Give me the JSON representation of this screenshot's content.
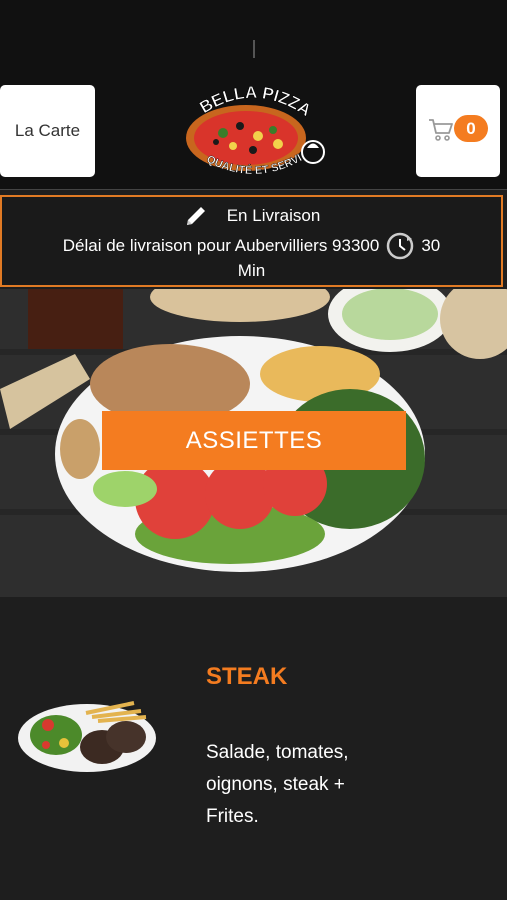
{
  "header": {
    "menu_button_label": "La Carte",
    "logo_title": "BELLA PIZZA",
    "logo_tagline": "QUALITÉ ET SERVICE",
    "cart_count": "0",
    "cart_icon": "cart-icon",
    "accent_color": "#f47c20"
  },
  "delivery": {
    "mode_icon": "pencil-icon",
    "mode_label": "En Livraison",
    "delay_text": "Délai de livraison pour Aubervilliers 93300",
    "clock_icon": "clock-icon",
    "delay_value": "30",
    "delay_unit": "Min"
  },
  "hero": {
    "category_label": "ASSIETTES"
  },
  "items": [
    {
      "title": "STEAK",
      "description": "Salade, tomates,\noignons, steak  +\nFrites."
    }
  ]
}
